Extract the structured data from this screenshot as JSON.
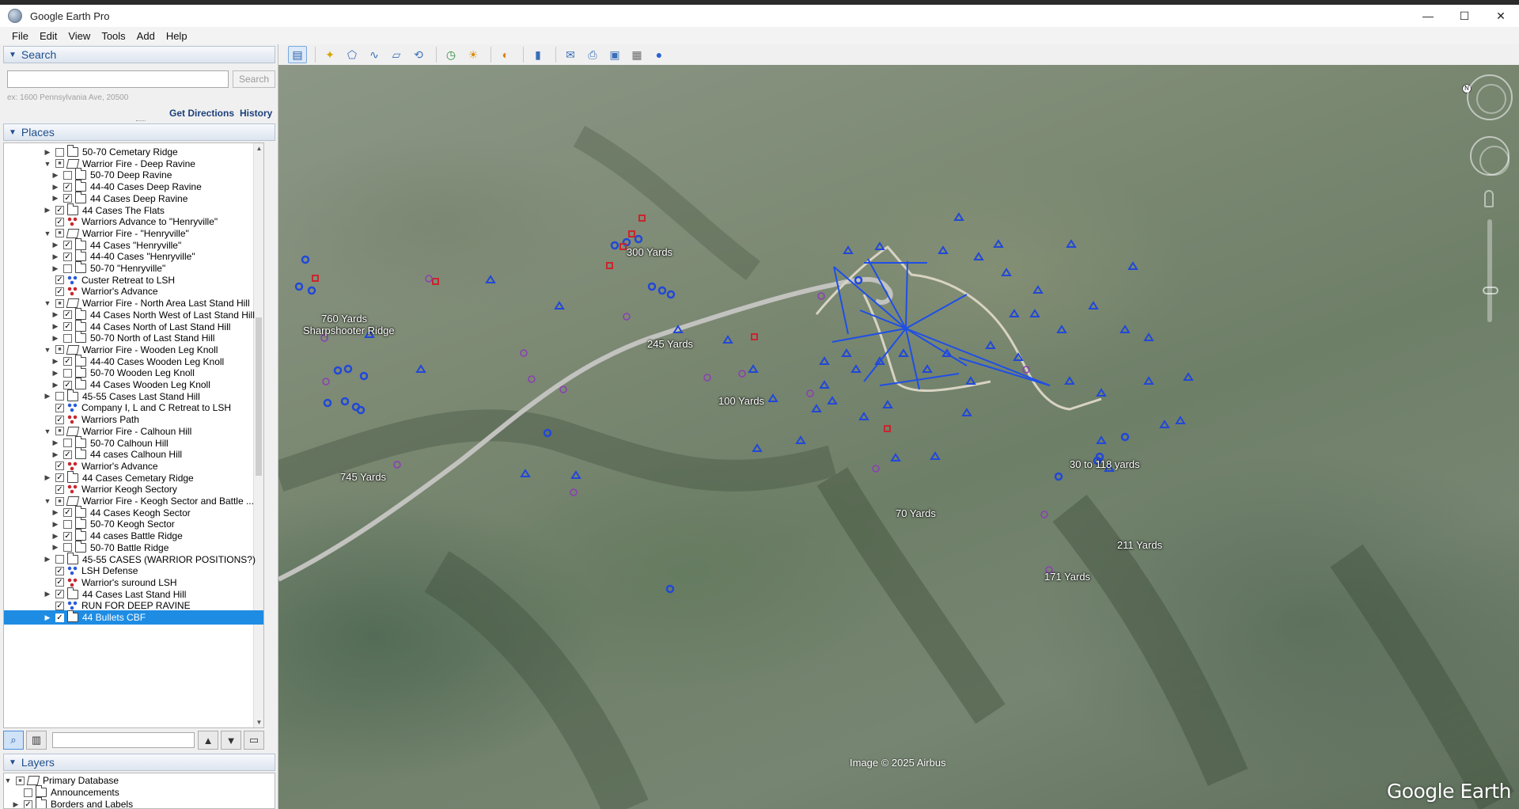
{
  "window": {
    "title": "Google Earth Pro",
    "minimize": "—",
    "maximize": "☐",
    "close": "✕"
  },
  "menu": [
    "File",
    "Edit",
    "View",
    "Tools",
    "Add",
    "Help"
  ],
  "search": {
    "header": "Search",
    "placeholder": "",
    "button": "Search",
    "hint": "ex: 1600 Pennsylvania Ave, 20500",
    "get_directions": "Get Directions",
    "history": "History"
  },
  "places": {
    "header": "Places",
    "items": [
      {
        "label": "50-70 Cemetary Ridge",
        "indent": 1,
        "expander": "closed",
        "checked": false,
        "icon": "folder"
      },
      {
        "label": "Warrior Fire - Deep Ravine",
        "indent": 1,
        "expander": "open",
        "checked": "partial",
        "icon": "open-folder"
      },
      {
        "label": "50-70 Deep Ravine",
        "indent": 2,
        "expander": "closed",
        "checked": false,
        "icon": "folder"
      },
      {
        "label": "44-40 Cases Deep Ravine",
        "indent": 2,
        "expander": "closed",
        "checked": true,
        "icon": "folder"
      },
      {
        "label": "44 Cases Deep Ravine",
        "indent": 2,
        "expander": "closed",
        "checked": true,
        "icon": "folder"
      },
      {
        "label": "44 Cases The Flats",
        "indent": 1,
        "expander": "closed",
        "checked": true,
        "icon": "folder"
      },
      {
        "label": "Warriors Advance to \"Henryville\"",
        "indent": 1,
        "expander": "none",
        "checked": true,
        "icon": "pin-red"
      },
      {
        "label": "Warrior Fire - \"Henryville\"",
        "indent": 1,
        "expander": "open",
        "checked": "partial",
        "icon": "open-folder"
      },
      {
        "label": "44 Cases \"Henryville\"",
        "indent": 2,
        "expander": "closed",
        "checked": true,
        "icon": "folder"
      },
      {
        "label": "44-40 Cases \"Henryville\"",
        "indent": 2,
        "expander": "closed",
        "checked": true,
        "icon": "folder"
      },
      {
        "label": "50-70 \"Henryville\"",
        "indent": 2,
        "expander": "closed",
        "checked": false,
        "icon": "folder"
      },
      {
        "label": "Custer Retreat to LSH",
        "indent": 1,
        "expander": "none",
        "checked": true,
        "icon": "pin-blue"
      },
      {
        "label": "Warrior's Advance",
        "indent": 1,
        "expander": "none",
        "checked": true,
        "icon": "pin-red"
      },
      {
        "label": "Warrior Fire - North Area Last Stand Hill",
        "indent": 1,
        "expander": "open",
        "checked": "partial",
        "icon": "open-folder"
      },
      {
        "label": "44 Cases North West of Last Stand Hill",
        "indent": 2,
        "expander": "closed",
        "checked": true,
        "icon": "folder"
      },
      {
        "label": "44 Cases North of Last Stand Hill",
        "indent": 2,
        "expander": "closed",
        "checked": true,
        "icon": "folder"
      },
      {
        "label": "50-70 North of Last Stand Hill",
        "indent": 2,
        "expander": "closed",
        "checked": false,
        "icon": "folder"
      },
      {
        "label": "Warrior Fire - Wooden Leg Knoll",
        "indent": 1,
        "expander": "open",
        "checked": "partial",
        "icon": "open-folder"
      },
      {
        "label": "44-40 Cases Wooden Leg Knoll",
        "indent": 2,
        "expander": "closed",
        "checked": true,
        "icon": "folder"
      },
      {
        "label": "50-70 Wooden Leg Knoll",
        "indent": 2,
        "expander": "closed",
        "checked": false,
        "icon": "folder"
      },
      {
        "label": "44 Cases Wooden Leg Knoll",
        "indent": 2,
        "expander": "closed",
        "checked": true,
        "icon": "folder"
      },
      {
        "label": "45-55 Cases Last Stand Hill",
        "indent": 1,
        "expander": "closed",
        "checked": false,
        "icon": "folder"
      },
      {
        "label": "Company I, L and C  Retreat to LSH",
        "indent": 1,
        "expander": "none",
        "checked": true,
        "icon": "pin-blue"
      },
      {
        "label": "Warriors Path",
        "indent": 1,
        "expander": "none",
        "checked": true,
        "icon": "pin-red"
      },
      {
        "label": "Warrior Fire - Calhoun Hill",
        "indent": 1,
        "expander": "open",
        "checked": "partial",
        "icon": "open-folder"
      },
      {
        "label": "50-70 Calhoun Hill",
        "indent": 2,
        "expander": "closed",
        "checked": false,
        "icon": "folder"
      },
      {
        "label": "44 cases Calhoun Hill",
        "indent": 2,
        "expander": "closed",
        "checked": true,
        "icon": "folder"
      },
      {
        "label": "Warrior's Advance",
        "indent": 1,
        "expander": "none",
        "checked": true,
        "icon": "pin-red"
      },
      {
        "label": "44 Cases Cemetary Ridge",
        "indent": 1,
        "expander": "closed",
        "checked": true,
        "icon": "folder"
      },
      {
        "label": "Warrior Keogh Sectory",
        "indent": 1,
        "expander": "none",
        "checked": true,
        "icon": "pin-red"
      },
      {
        "label": "Warrior Fire - Keogh Sector and Battle ...",
        "indent": 1,
        "expander": "open",
        "checked": "partial",
        "icon": "open-folder"
      },
      {
        "label": "44 Cases Keogh Sector",
        "indent": 2,
        "expander": "closed",
        "checked": true,
        "icon": "folder"
      },
      {
        "label": "50-70 Keogh Sector",
        "indent": 2,
        "expander": "closed",
        "checked": false,
        "icon": "folder"
      },
      {
        "label": "44 cases Battle Ridge",
        "indent": 2,
        "expander": "closed",
        "checked": true,
        "icon": "folder"
      },
      {
        "label": "50-70 Battle Ridge",
        "indent": 2,
        "expander": "closed",
        "checked": false,
        "icon": "folder"
      },
      {
        "label": "45-55 CASES (WARRIOR POSITIONS?)",
        "indent": 1,
        "expander": "closed",
        "checked": false,
        "icon": "folder"
      },
      {
        "label": "LSH Defense",
        "indent": 1,
        "expander": "none",
        "checked": true,
        "icon": "pin-blue"
      },
      {
        "label": "Warrior's suround LSH",
        "indent": 1,
        "expander": "none",
        "checked": true,
        "icon": "pin-red"
      },
      {
        "label": "44 Cases Last Stand Hill",
        "indent": 1,
        "expander": "closed",
        "checked": true,
        "icon": "folder"
      },
      {
        "label": "RUN FOR DEEP RAVINE",
        "indent": 1,
        "expander": "none",
        "checked": true,
        "icon": "pin-blue"
      },
      {
        "label": "44 Bullets CBF",
        "indent": 1,
        "expander": "closed",
        "checked": true,
        "icon": "folder",
        "selected": true
      }
    ]
  },
  "layers": {
    "header": "Layers",
    "items": [
      {
        "label": "Primary Database",
        "indent": 0,
        "expander": "open",
        "checked": "partial",
        "icon": "layers"
      },
      {
        "label": "Announcements",
        "indent": 1,
        "expander": "none",
        "checked": false,
        "icon": "envelope"
      },
      {
        "label": "Borders and Labels",
        "indent": 1,
        "expander": "closed",
        "checked": true,
        "icon": "folder"
      }
    ]
  },
  "map": {
    "labels": [
      {
        "text": "300 Yards"
      },
      {
        "text": "760 Yards"
      },
      {
        "text": "Sharpshooter Ridge"
      },
      {
        "text": "245 Yards"
      },
      {
        "text": "100 Yards"
      },
      {
        "text": "745 Yards"
      },
      {
        "text": "70 Yards"
      },
      {
        "text": "30 to 118 yards"
      },
      {
        "text": "211 Yards"
      },
      {
        "text": "171 Yards"
      }
    ],
    "attribution": "Image © 2025 Airbus",
    "logo": "Google Earth",
    "north_label": "N"
  },
  "colors": {
    "accent": "#1e8ce3",
    "marker_blue": "#2148d8",
    "marker_red": "#c8262d",
    "marker_purple": "#8a3fb5",
    "line_blue": "#1f4fe6",
    "road": "#b9b9b6"
  }
}
